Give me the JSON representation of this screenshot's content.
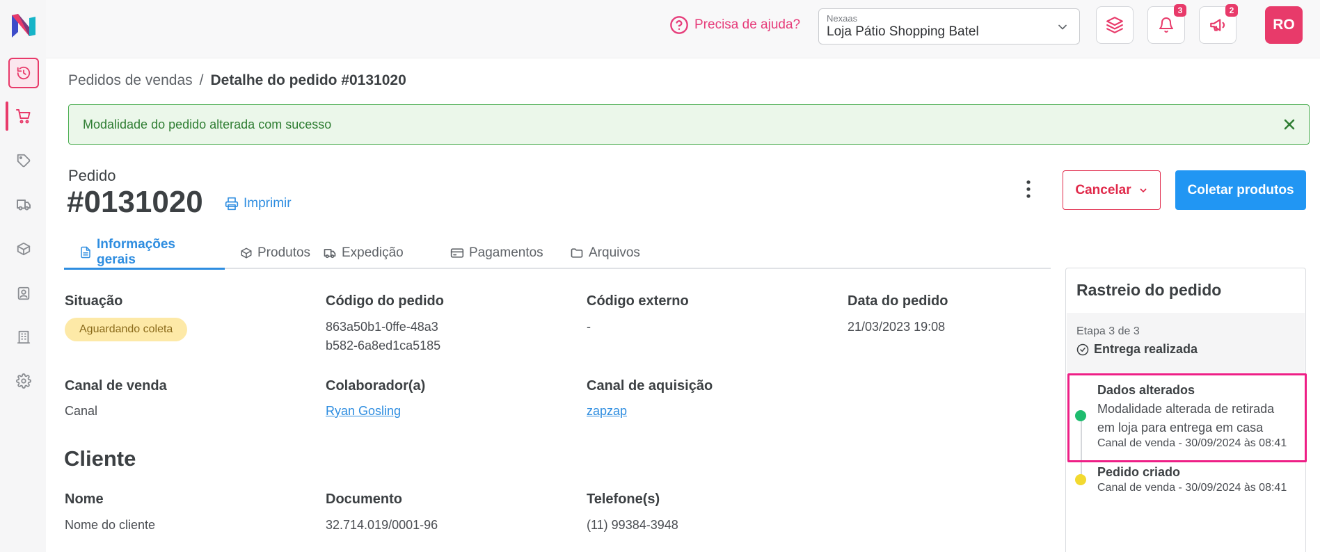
{
  "colors": {
    "brand_pink": "#e83a6a",
    "primary_blue": "#2196f3",
    "success_green": "#2e7d32",
    "status_pending": "#fde9a7",
    "highlight_magenta": "#ee1f86",
    "timeline_green": "#1ebc6e",
    "timeline_yellow": "#f2d930"
  },
  "sidebar": {
    "items": [
      {
        "icon": "history-icon"
      },
      {
        "icon": "cart-icon"
      },
      {
        "icon": "tag-icon"
      },
      {
        "icon": "truck-icon"
      },
      {
        "icon": "box-icon"
      },
      {
        "icon": "contact-card-icon"
      },
      {
        "icon": "building-icon"
      },
      {
        "icon": "gear-icon"
      }
    ]
  },
  "header": {
    "help_label": "Precisa de ajuda?",
    "store_select": {
      "small_label": "Nexaas",
      "value": "Loja Pátio Shopping Batel"
    },
    "notifications_count": "3",
    "announcements_count": "2",
    "avatar_initials": "RO"
  },
  "breadcrumb": {
    "parent": "Pedidos de vendas",
    "separator": "/",
    "current": "Detalhe do pedido #0131020"
  },
  "alert": {
    "message": "Modalidade do pedido alterada com sucesso"
  },
  "order": {
    "label": "Pedido",
    "number": "#0131020",
    "print_label": "Imprimir",
    "cancel_label": "Cancelar",
    "collect_label": "Coletar produtos"
  },
  "tabs": [
    {
      "label": "Informações gerais",
      "icon": "document-icon",
      "active": true
    },
    {
      "label": "Produtos",
      "icon": "box-icon",
      "active": false
    },
    {
      "label": "Expedição",
      "icon": "truck-icon",
      "active": false
    },
    {
      "label": "Pagamentos",
      "icon": "credit-card-icon",
      "active": false
    },
    {
      "label": "Arquivos",
      "icon": "folder-icon",
      "active": false
    }
  ],
  "general": {
    "situacao": {
      "label": "Situação",
      "value": "Aguardando coleta"
    },
    "codigo_pedido": {
      "label": "Código do pedido",
      "line1": "863a50b1-0ffe-48a3",
      "line2": "b582-6a8ed1ca5185"
    },
    "codigo_externo": {
      "label": "Código externo",
      "value": "-"
    },
    "data_pedido": {
      "label": "Data do pedido",
      "value": "21/03/2023 19:08"
    },
    "canal_venda": {
      "label": "Canal de venda",
      "value": "Canal"
    },
    "colaborador": {
      "label": "Colaborador(a)",
      "value": "Ryan Gosling"
    },
    "canal_aquisicao": {
      "label": "Canal de aquisição",
      "value": "zapzap"
    }
  },
  "cliente": {
    "title": "Cliente",
    "nome": {
      "label": "Nome",
      "value": "Nome do cliente"
    },
    "documento": {
      "label": "Documento",
      "value": "32.714.019/0001-96"
    },
    "telefone": {
      "label": "Telefone(s)",
      "value": "(11) 99384-3948"
    }
  },
  "tracking": {
    "title": "Rastreio do pedido",
    "step": "Etapa 3 de 3",
    "step_status": "Entrega realizada",
    "events": [
      {
        "title": "Dados alterados",
        "desc_line1": "Modalidade alterada de retirada",
        "desc_line2": "em loja para entrega em casa",
        "meta": "Canal de venda - 30/09/2024 às 08:41"
      },
      {
        "title": "Pedido criado",
        "meta": "Canal de venda - 30/09/2024 às 08:41"
      }
    ]
  }
}
